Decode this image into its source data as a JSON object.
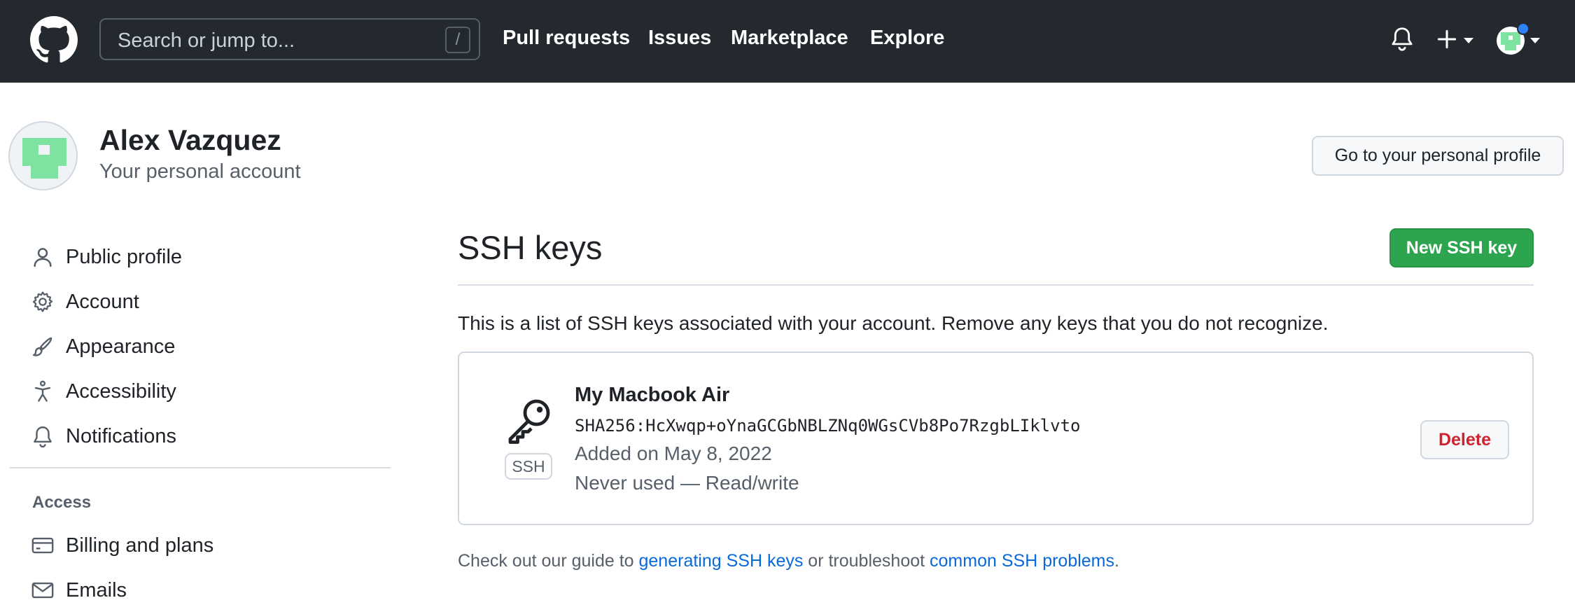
{
  "header": {
    "search_placeholder": "Search or jump to...",
    "search_shortcut": "/",
    "nav": [
      {
        "label": "Pull requests"
      },
      {
        "label": "Issues"
      },
      {
        "label": "Marketplace"
      },
      {
        "label": "Explore"
      }
    ],
    "icons": [
      "github-logo-icon",
      "bell-icon",
      "plus-icon",
      "chevron-down-icon",
      "avatar"
    ]
  },
  "profile": {
    "name": "Alex Vazquez",
    "subtitle": "Your personal account",
    "go_to_profile_label": "Go to your personal profile"
  },
  "sidebar": {
    "items": [
      {
        "label": "Public profile",
        "icon": "person-icon"
      },
      {
        "label": "Account",
        "icon": "gear-icon"
      },
      {
        "label": "Appearance",
        "icon": "paintbrush-icon"
      },
      {
        "label": "Accessibility",
        "icon": "accessibility-icon"
      },
      {
        "label": "Notifications",
        "icon": "bell-icon"
      }
    ],
    "access_heading": "Access",
    "access_items": [
      {
        "label": "Billing and plans",
        "icon": "credit-card-icon"
      },
      {
        "label": "Emails",
        "icon": "mail-icon"
      }
    ]
  },
  "main": {
    "title": "SSH keys",
    "new_key_label": "New SSH key",
    "description": "This is a list of SSH keys associated with your account. Remove any keys that you do not recognize.",
    "keys": [
      {
        "badge": "SSH",
        "title": "My Macbook Air",
        "fingerprint": "SHA256:HcXwqp+oYnaGCGbNBLZNq0WGsCVb8Po7RzgbLIklvto",
        "added": "Added on May 8, 2022",
        "usage": "Never used — Read/write",
        "delete_label": "Delete"
      }
    ],
    "guide": {
      "prefix": "Check out our guide to ",
      "link1": "generating SSH keys",
      "middle": " or troubleshoot ",
      "link2": "common SSH problems",
      "suffix": "."
    }
  },
  "colors": {
    "header_bg": "#24292f",
    "primary_button": "#2da44e",
    "danger": "#cf222e",
    "link": "#0969da",
    "avatar_green": "#7ee2a0",
    "notification_dot": "#2f81f7"
  }
}
